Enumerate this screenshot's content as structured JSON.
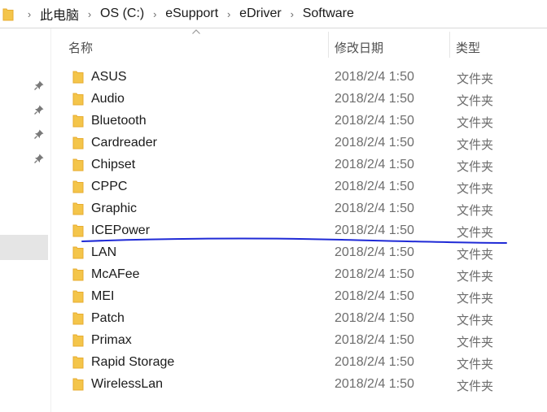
{
  "breadcrumb": {
    "items": [
      {
        "label": "此电脑"
      },
      {
        "label": "OS (C:)"
      },
      {
        "label": "eSupport"
      },
      {
        "label": "eDriver"
      },
      {
        "label": "Software"
      }
    ],
    "separator_glyph": "›"
  },
  "columns": {
    "name": "名称",
    "modified": "修改日期",
    "type": "类型"
  },
  "files": [
    {
      "name": "ASUS",
      "modified": "2018/2/4 1:50",
      "type": "文件夹"
    },
    {
      "name": "Audio",
      "modified": "2018/2/4 1:50",
      "type": "文件夹"
    },
    {
      "name": "Bluetooth",
      "modified": "2018/2/4 1:50",
      "type": "文件夹"
    },
    {
      "name": "Cardreader",
      "modified": "2018/2/4 1:50",
      "type": "文件夹"
    },
    {
      "name": "Chipset",
      "modified": "2018/2/4 1:50",
      "type": "文件夹"
    },
    {
      "name": "CPPC",
      "modified": "2018/2/4 1:50",
      "type": "文件夹"
    },
    {
      "name": "Graphic",
      "modified": "2018/2/4 1:50",
      "type": "文件夹"
    },
    {
      "name": "ICEPower",
      "modified": "2018/2/4 1:50",
      "type": "文件夹"
    },
    {
      "name": "LAN",
      "modified": "2018/2/4 1:50",
      "type": "文件夹"
    },
    {
      "name": "McAFee",
      "modified": "2018/2/4 1:50",
      "type": "文件夹"
    },
    {
      "name": "MEI",
      "modified": "2018/2/4 1:50",
      "type": "文件夹"
    },
    {
      "name": "Patch",
      "modified": "2018/2/4 1:50",
      "type": "文件夹"
    },
    {
      "name": "Primax",
      "modified": "2018/2/4 1:50",
      "type": "文件夹"
    },
    {
      "name": "Rapid Storage",
      "modified": "2018/2/4 1:50",
      "type": "文件夹"
    },
    {
      "name": "WirelessLan",
      "modified": "2018/2/4 1:50",
      "type": "文件夹"
    }
  ],
  "icons": {
    "folder": "folder-icon",
    "pin": "pin-icon",
    "sort": "sort-ascending-icon"
  },
  "colors": {
    "folder_fill": "#f4c54a",
    "folder_tab": "#e7ac2f",
    "annotation_stroke": "#1f2ad6",
    "nav_selected": "#e5e5e5"
  }
}
